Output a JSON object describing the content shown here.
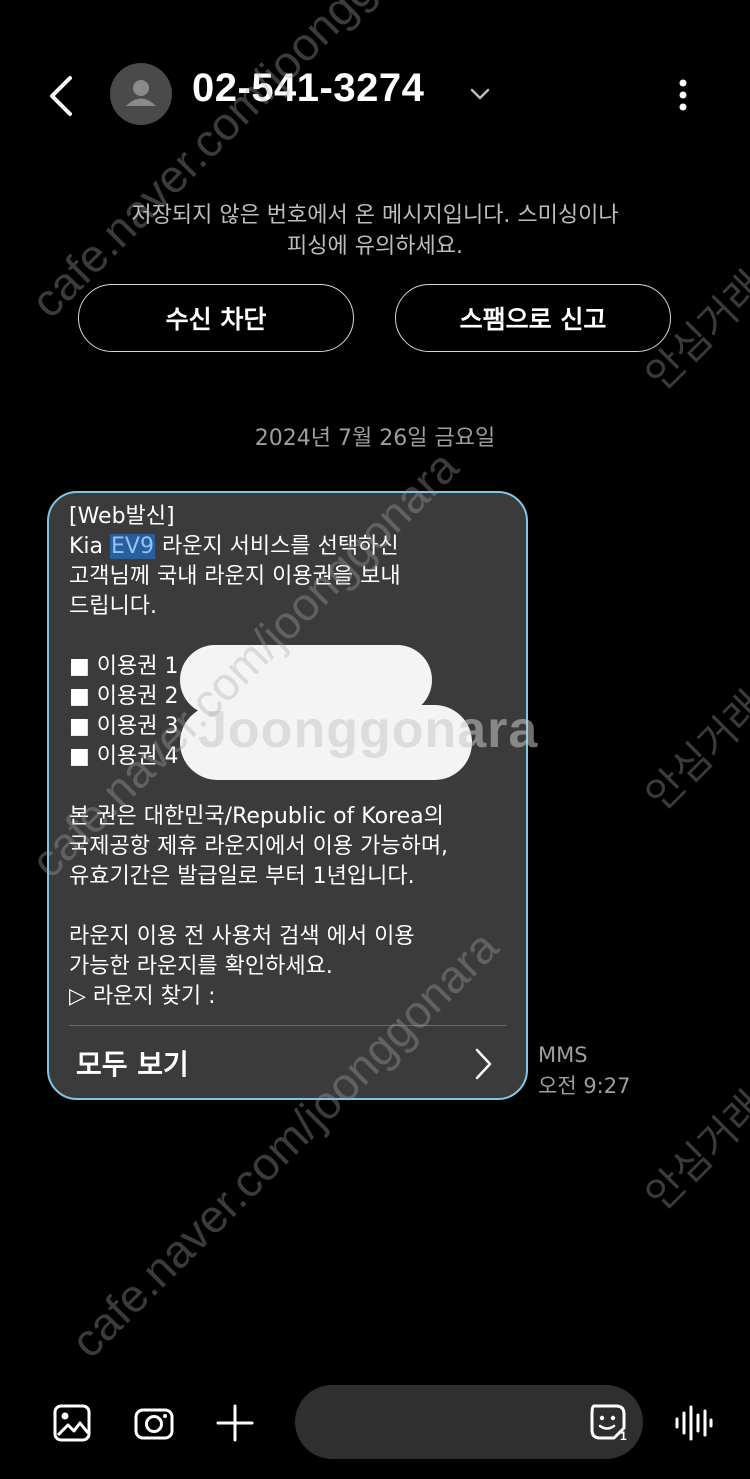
{
  "header": {
    "phone_number": "02-541-3274"
  },
  "notice": {
    "line1": "저장되지 않은 번호에서 온 메시지입니다. 스미싱이나",
    "line2": "피싱에 유의하세요."
  },
  "actions": {
    "block_label": "수신 차단",
    "spam_label": "스팸으로 신고"
  },
  "date_divider": "2024년 7월 26일 금요일",
  "message": {
    "line1": "[Web발신]",
    "line2_pre": "Kia ",
    "line2_highlight": "EV9",
    "line2_post": " 라운지 서비스를 선택하신",
    "line3": "고객님께 국내 라운지 이용권을 보내",
    "line4": "드립니다.",
    "coupon1": "■ 이용권 1",
    "coupon2": "■ 이용권 2",
    "coupon3": "■ 이용권 3",
    "coupon4": "■ 이용권 4",
    "para2_line1": "본 권은 대한민국/Republic of Korea의",
    "para2_line2": "국제공항 제휴 라운지에서 이용 가능하며,",
    "para2_line3": "유효기간은 발급일로 부터 1년입니다.",
    "para3_line1": "라운지 이용 전 사용처 검색 에서 이용",
    "para3_line2": "가능한 라운지를 확인하세요.",
    "find_lounge": "▷ 라운지 찾기 :",
    "view_all": "모두 보기",
    "type": "MMS",
    "time": "오전 9:27"
  },
  "watermarks": {
    "logo": "Joonggonara",
    "url": "cafe.naver.com/joonggonara",
    "korean": "안심거래"
  },
  "icons": [
    "back-arrow-icon",
    "contact-avatar-icon",
    "chevron-down-icon",
    "more-vert-icon",
    "chevron-right-icon",
    "gallery-icon",
    "camera-icon",
    "plus-icon",
    "emoji-sticker-icon",
    "voice-waveform-icon"
  ]
}
